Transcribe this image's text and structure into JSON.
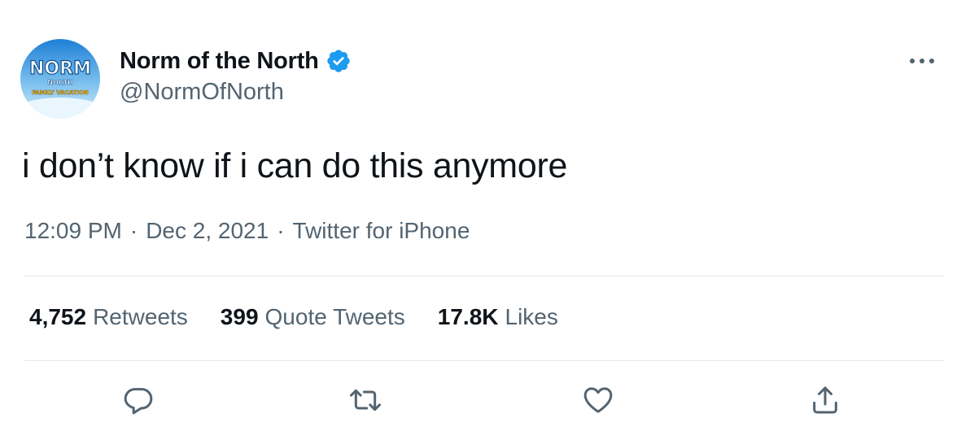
{
  "author": {
    "display_name": "Norm of the North",
    "handle": "@NormOfNorth",
    "verified": true,
    "avatar_logo_text": "NORM",
    "avatar_logo_sub1": "NORTH",
    "avatar_logo_sub2": "FAMILY VACATION"
  },
  "tweet": {
    "text": "i don’t know if i can do this anymore",
    "time": "12:09 PM",
    "date": "Dec 2, 2021",
    "source": "Twitter for iPhone",
    "separator": "·"
  },
  "stats": {
    "retweets_count": "4,752",
    "retweets_label": "Retweets",
    "quotes_count": "399",
    "quotes_label": "Quote Tweets",
    "likes_count": "17.8K",
    "likes_label": "Likes"
  },
  "actions": {
    "reply_icon": "reply-icon",
    "retweet_icon": "retweet-icon",
    "like_icon": "heart-icon",
    "share_icon": "share-icon"
  },
  "colors": {
    "verified_blue": "#1d9bf0",
    "text_primary": "#0f1419",
    "text_secondary": "#536471",
    "divider": "#e1e8ed"
  }
}
